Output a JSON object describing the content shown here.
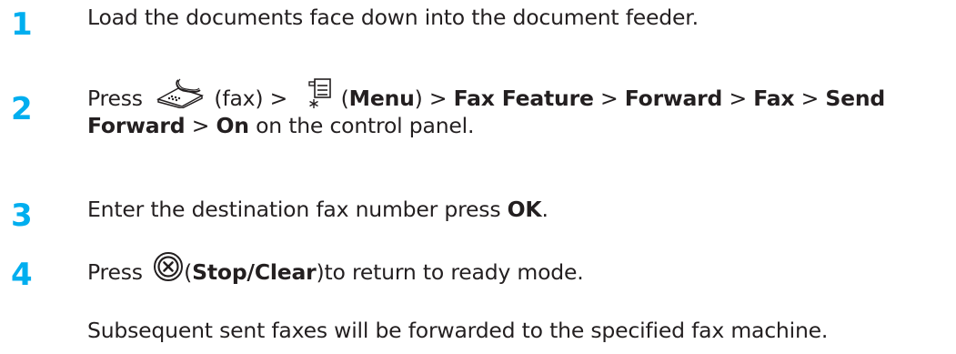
{
  "steps": [
    {
      "number": "1",
      "text": "Load the documents face down into the document feeder."
    },
    {
      "number": "2",
      "press": "Press",
      "fax_label": "(fax) >",
      "menu_open": "(",
      "menu_label": "Menu",
      "menu_close": ") >",
      "fax_feature": "Fax Feature",
      "sep": ">",
      "forward": "Forward",
      "fax": "Fax",
      "send": "Send",
      "forward2": "Forward",
      "on": "On",
      "tail": "on the control panel."
    },
    {
      "number": "3",
      "text": "Enter the destination fax number press",
      "ok": "OK",
      "end": "."
    },
    {
      "number": "4",
      "press": "Press",
      "stop_open": "(",
      "stop_label": "Stop/Clear",
      "stop_close": ")to return to ready mode."
    }
  ],
  "note": "Subsequent sent faxes will be forwarded to the specified fax machine.",
  "icons": {
    "fax": "fax-icon",
    "menu": "menu-icon",
    "stop": "stop-clear-icon"
  },
  "colors": {
    "step_number": "#00aeef",
    "text": "#231f20"
  }
}
